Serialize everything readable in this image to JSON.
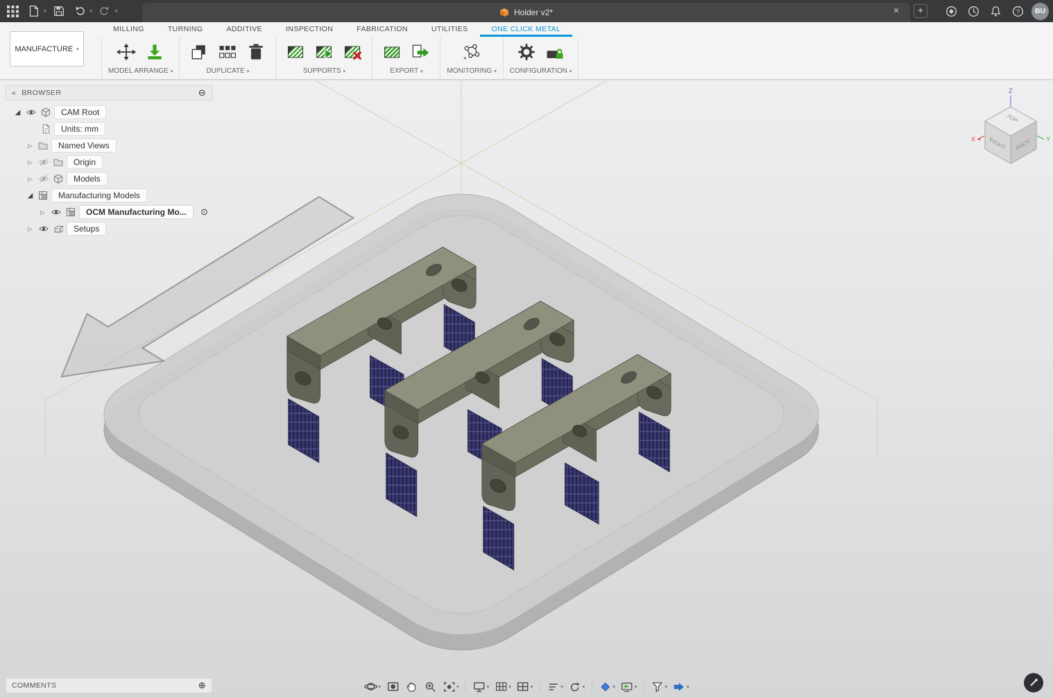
{
  "app": {
    "document_tab": "Holder v2*",
    "user_initials": "BU"
  },
  "workspace": {
    "label": "MANUFACTURE"
  },
  "tabs": [
    {
      "label": "MILLING"
    },
    {
      "label": "TURNING"
    },
    {
      "label": "ADDITIVE"
    },
    {
      "label": "INSPECTION"
    },
    {
      "label": "FABRICATION"
    },
    {
      "label": "UTILITIES"
    },
    {
      "label": "ONE CLICK METAL",
      "active": true
    }
  ],
  "groups": [
    {
      "label": "MODEL ARRANGE"
    },
    {
      "label": "DUPLICATE"
    },
    {
      "label": "SUPPORTS"
    },
    {
      "label": "EXPORT"
    },
    {
      "label": "MONITORING"
    },
    {
      "label": "CONFIGURATION"
    }
  ],
  "browser": {
    "title": "BROWSER",
    "items": [
      {
        "label": "CAM Root"
      },
      {
        "label": "Units: mm"
      },
      {
        "label": "Named Views"
      },
      {
        "label": "Origin"
      },
      {
        "label": "Models"
      },
      {
        "label": "Manufacturing Models"
      },
      {
        "label": "OCM Manufacturing Mo...",
        "active": true
      },
      {
        "label": "Setups"
      }
    ]
  },
  "viewcube": {
    "top": "TOP",
    "left_face": "RIGHT",
    "right_face": "BACK",
    "axis_x": "X",
    "axis_y": "Y",
    "axis_z": "Z"
  },
  "comments": {
    "title": "COMMENTS"
  },
  "scene": {
    "parts_count": 3
  },
  "nav": {
    "icons": [
      "orbit",
      "look-at",
      "pan",
      "zoom",
      "fit",
      "display-settings",
      "grid-and-snaps",
      "viewports",
      "layers",
      "refresh",
      "material-view",
      "screen-preview",
      "filter",
      "step"
    ]
  },
  "titlebar_icons": [
    "app-grid",
    "file-new",
    "save",
    "undo",
    "redo",
    "extensions",
    "job-status",
    "notifications",
    "help"
  ],
  "ui": {
    "caret": "▾",
    "collapse": "«",
    "remove": "⊖",
    "add": "⊕",
    "target": "⊙",
    "close": "×",
    "plus": "+"
  },
  "colors": {
    "accent": "#0a96d7",
    "part_olive": "#90907f",
    "supports_navy": "#34346a",
    "plate_gray": "#cdcdcd",
    "green_icon": "#3fa31c",
    "tab_orange": "#f0a050"
  }
}
